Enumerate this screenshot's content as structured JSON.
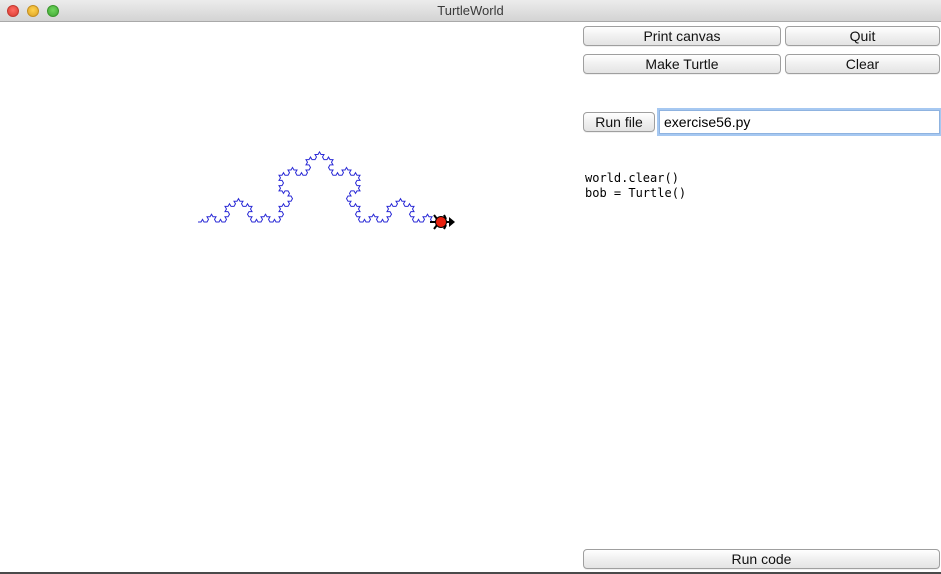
{
  "window": {
    "title": "TurtleWorld"
  },
  "toolbar": {
    "print_canvas_label": "Print canvas",
    "quit_label": "Quit",
    "make_turtle_label": "Make Turtle",
    "clear_label": "Clear",
    "run_file_label": "Run file",
    "run_code_label": "Run code"
  },
  "file_input": {
    "value": "exercise56.py"
  },
  "code": {
    "lines": [
      "world.clear()",
      "bob = Turtle()"
    ]
  },
  "canvas": {
    "curve_color": "#2b2bd6",
    "turtle_color": "#e8200e",
    "koch_depth": 4,
    "turtle_heading": "east"
  }
}
